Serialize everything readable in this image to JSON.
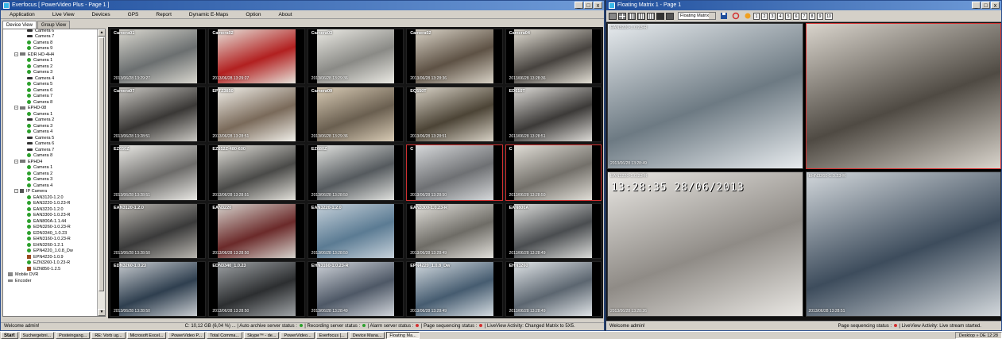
{
  "left_window": {
    "title": "Everfocus [ PowerVideo Plus - Page 1 ]",
    "controls": {
      "min": "_",
      "max": "□",
      "close": "x"
    },
    "menu": [
      "Application",
      "Live View",
      "Devices",
      "GPS",
      "Report",
      "Dynamic E-Maps",
      "Option",
      "About"
    ],
    "tabs": [
      "Device View",
      "Group View"
    ],
    "tree": [
      {
        "label": "Camera 3",
        "icon": "camera-green"
      },
      {
        "label": "Camera 4",
        "icon": "camera-green"
      },
      {
        "label": "Camera 5",
        "icon": "camera-dark"
      },
      {
        "label": "Camera 6",
        "icon": "camera-dark"
      },
      {
        "label": "Camera 7",
        "icon": "camera-dark"
      },
      {
        "label": "Camera 8",
        "icon": "camera-green"
      },
      {
        "label": "Camera 9",
        "icon": "camera-green"
      },
      {
        "label": "EDR HD-4H4",
        "icon": "recorder",
        "expander": "−",
        "level": 0
      },
      {
        "label": "Camera 1",
        "icon": "camera-green"
      },
      {
        "label": "Camera 2",
        "icon": "camera-green"
      },
      {
        "label": "Camera 3",
        "icon": "camera-green"
      },
      {
        "label": "Camera 4",
        "icon": "camera-dark"
      },
      {
        "label": "Camera 5",
        "icon": "camera-green"
      },
      {
        "label": "Camera 6",
        "icon": "camera-green"
      },
      {
        "label": "Camera 7",
        "icon": "camera-green"
      },
      {
        "label": "Camera 8",
        "icon": "camera-green"
      },
      {
        "label": "EPHD-08",
        "icon": "recorder",
        "expander": "−",
        "level": 0
      },
      {
        "label": "Camera 1",
        "icon": "camera-green"
      },
      {
        "label": "Camera 2",
        "icon": "camera-dark"
      },
      {
        "label": "Camera 3",
        "icon": "camera-green"
      },
      {
        "label": "Camera 4",
        "icon": "camera-green"
      },
      {
        "label": "Camera 5",
        "icon": "camera-dark"
      },
      {
        "label": "Camera 6",
        "icon": "camera-dark"
      },
      {
        "label": "Camera 7",
        "icon": "camera-dark"
      },
      {
        "label": "Camera 8",
        "icon": "camera-green"
      },
      {
        "label": "EPHD4",
        "icon": "recorder",
        "expander": "−",
        "level": 0
      },
      {
        "label": "Camera 1",
        "icon": "camera-green"
      },
      {
        "label": "Camera 2",
        "icon": "camera-green"
      },
      {
        "label": "Camera 3",
        "icon": "camera-green"
      },
      {
        "label": "Camera 4",
        "icon": "camera-green"
      },
      {
        "label": "IP Camera",
        "icon": "ip",
        "expander": "−",
        "level": 0
      },
      {
        "label": "EAN3120-1.2.0",
        "icon": "camera-green"
      },
      {
        "label": "EAN3220-1.0.23-R",
        "icon": "camera-green"
      },
      {
        "label": "EAN3220-1.2.0",
        "icon": "camera-green"
      },
      {
        "label": "EAN3300-1.0.23-R",
        "icon": "camera-green"
      },
      {
        "label": "EAN800A-1.1.44",
        "icon": "camera-green"
      },
      {
        "label": "EDN3260-1.0.23-R",
        "icon": "camera-green"
      },
      {
        "label": "EDN3340_1.0.23",
        "icon": "camera-green"
      },
      {
        "label": "EHN3160-1.0.23-R",
        "icon": "camera-green"
      },
      {
        "label": "EHN3260-1.2.1",
        "icon": "camera-green"
      },
      {
        "label": "EPN4220_1.0.8_Dw",
        "icon": "camera-green"
      },
      {
        "label": "EPN4220-1.0.9",
        "icon": "ptz"
      },
      {
        "label": "EZN3260-1.0.23-R",
        "icon": "camera-green"
      },
      {
        "label": "EZN850-1.2.5",
        "icon": "ptz"
      },
      {
        "label": "Mobile DVR",
        "icon": "dvr",
        "level": -1
      },
      {
        "label": "Encoder",
        "icon": "encoder",
        "level": -1
      }
    ],
    "tiles": [
      {
        "name": "Camera01",
        "ts": "2013/06/28  13:29:27",
        "c1": "#6b6f70",
        "c2": "#d9d7cf",
        "sel": false
      },
      {
        "name": "Camera02",
        "ts": "2013/06/28  13:29:27",
        "c1": "#b22020",
        "c2": "#e6e2da",
        "sel": false
      },
      {
        "name": "Camera03",
        "ts": "2013/06/28  13:29:36",
        "c1": "#8a8a86",
        "c2": "#ebeae4",
        "sel": false
      },
      {
        "name": "Camera02",
        "ts": "2013/06/28  13:28:36",
        "c1": "#5e5245",
        "c2": "#d8d2c6",
        "sel": false
      },
      {
        "name": "Camera04",
        "ts": "2013/06/28  13:28:36",
        "c1": "#47433f",
        "c2": "#e2ded4",
        "sel": false
      },
      {
        "name": "Camera07",
        "ts": "2013/06/28  13:28:51",
        "c1": "#3a3836",
        "c2": "#c9c7c2",
        "sel": false
      },
      {
        "name": "EPTZ3850",
        "ts": "2013/06/28  13:28:51",
        "c1": "#7a6a5a",
        "c2": "#f1efe9",
        "sel": false
      },
      {
        "name": "Camera09",
        "ts": "2013/06/28  13:29:36",
        "c1": "#6a5f50",
        "c2": "#d8cbb5",
        "sel": false
      },
      {
        "name": "EQ550T",
        "ts": "2013/06/28  13:28:51",
        "c1": "#4c4436",
        "c2": "#d7d1c5",
        "sel": false
      },
      {
        "name": "ED610T",
        "ts": "2013/06/28  13:28:51",
        "c1": "#3c3a38",
        "c2": "#dcdad6",
        "sel": false
      },
      {
        "name": "EZ650Z",
        "ts": "2013/06/28  13:28:51",
        "c1": "#6d6c6a",
        "c2": "#e9e8e4",
        "sel": false
      },
      {
        "name": "EZ652Z-480-600",
        "ts": "2013/06/28  13:28:51",
        "c1": "#4a4a48",
        "c2": "#e2e0da",
        "sel": false
      },
      {
        "name": "EZ680Z",
        "ts": "2013/06/28  13:28:50",
        "c1": "#555a5e",
        "c2": "#dfe0dd",
        "sel": false
      },
      {
        "name": "C",
        "ts": "2013/06/28  13:28:50",
        "c1": "#6e7073",
        "c2": "#d6d8da",
        "sel": true
      },
      {
        "name": "C",
        "ts": "2013/06/28  13:28:50",
        "c1": "#73706a",
        "c2": "#e0ddd6",
        "sel": true
      },
      {
        "name": "EAN3120-1.2.0",
        "ts": "2013/06/28  13:28:50",
        "c1": "#3a3a3a",
        "c2": "#b9b6b0",
        "sel": false
      },
      {
        "name": "EAN3220",
        "ts": "2013/06/28  13:28:50",
        "c1": "#6b2a2a",
        "c2": "#d6d3cd",
        "sel": false
      },
      {
        "name": "EAN3220-1.2.0",
        "ts": "2013/06/28  13:28:50",
        "c1": "#5b7b93",
        "c2": "#c6d1da",
        "sel": false
      },
      {
        "name": "EAN3300-1.0.23-R",
        "ts": "2013/06/28  13:28:49",
        "c1": "#6e6c66",
        "c2": "#e2e0db",
        "sel": false
      },
      {
        "name": "EAN800A",
        "ts": "2013/06/28  13:28:49",
        "c1": "#4a4d50",
        "c2": "#dadbd9",
        "sel": false
      },
      {
        "name": "EDN3260-1.0.23",
        "ts": "2013/06/28  13:28:50",
        "c1": "#2f3f4f",
        "c2": "#c8ccd0",
        "sel": false
      },
      {
        "name": "EDN3340_1.0.23",
        "ts": "2013/06/28  13:28:50",
        "c1": "#2c2e30",
        "c2": "#9fa3a6",
        "sel": false
      },
      {
        "name": "EHN3160-1.0.23-R",
        "ts": "2013/06/28  13:28:49",
        "c1": "#4e5866",
        "c2": "#d0d4da",
        "sel": false
      },
      {
        "name": "EPN4220_1.0.8_Dw",
        "ts": "2013/06/28  13:28:49",
        "c1": "#465c70",
        "c2": "#d4dbe0",
        "sel": false
      },
      {
        "name": "EHN3260",
        "ts": "2013/06/28  13:28:49",
        "c1": "#5c6670",
        "c2": "#dfe3e6",
        "sel": false
      }
    ],
    "status": {
      "welcome": "Welcome admin!",
      "disk": "C: 10,12 GB (6,04 %) ...",
      "auto_archive": "Auto archive server status :",
      "recording": "Recording server status :",
      "alarm": "Alarm server status :",
      "page_seq": "Page sequencing status :",
      "liveview": "LiveView Activity: Changed Matrix to 5X5."
    }
  },
  "right_window": {
    "title": "Floating Matrix 1 - Page 1",
    "controls": {
      "min": "_",
      "max": "□",
      "close": "x"
    },
    "matrix_combo": "Floating Matrix 1",
    "page_buttons": [
      "1",
      "2",
      "3",
      "4",
      "5",
      "6",
      "7",
      "8",
      "9",
      "10"
    ],
    "tiles": [
      {
        "name": "EAN3220-1.0.23-R",
        "ts": "2013/06/28  13:28:49",
        "osd": "",
        "c1": "#6d7a83",
        "c2": "#e7ebee",
        "sel": false
      },
      {
        "name": "",
        "ts": "",
        "osd": "",
        "c1": "#4f4a43",
        "c2": "#d9d4cc",
        "sel": true
      },
      {
        "name": "EAN3220-1.0.23-R",
        "ts": "2013/06/28  13:28:26",
        "osd": "13:28:35 28/06/2013",
        "c1": "#8f8b86",
        "c2": "#e9e7e3",
        "sel": false
      },
      {
        "name": "EHN3260-1.0.23-R",
        "ts": "2013/06/28  13:28:51",
        "osd": "",
        "c1": "#3d4c5c",
        "c2": "#d2d7db",
        "sel": false
      }
    ],
    "status": {
      "welcome": "Welcome admin!",
      "page_seq": "Page sequencing status :",
      "liveview": "LiveView Activity: Live stream started."
    }
  },
  "taskbar": {
    "start": "Start",
    "items": [
      "Suchergebni...",
      "Posteingang...",
      "RE: Vorb ug...",
      "Microsoft Excel...",
      "PowerVideo P...",
      "Total Comma...",
      "Skype™ - de...",
      "PowerVideo...",
      "Everfocus [...",
      "Device Mana...",
      "Floating Ma..."
    ],
    "active_index": 10,
    "tray": "Desktop  »  DE   12:28"
  },
  "colors": {
    "ok": "#2ca02c",
    "alarm": "#d23030",
    "title_blue": "#1f4e9c",
    "selected_border": "#d23030"
  }
}
